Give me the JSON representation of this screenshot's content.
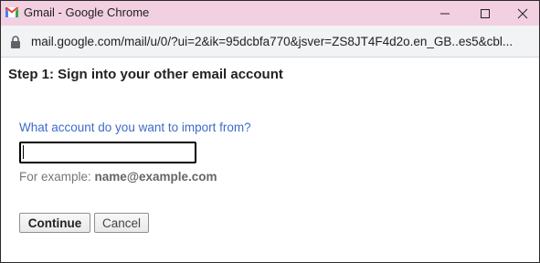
{
  "window": {
    "title": "Gmail - Google Chrome",
    "url": "mail.google.com/mail/u/0/?ui=2&ik=95dcbfa770&jsver=ZS8JT4F4d2o.en_GB..es5&cbl..."
  },
  "icons": {
    "app": "gmail-logo",
    "lock": "lock-icon",
    "minimize": "minimize-icon",
    "maximize": "maximize-icon",
    "close": "close-icon"
  },
  "colors": {
    "titlebar_bg": "#f2cfe1",
    "question_text": "#3d6bcc"
  },
  "form": {
    "step_title": "Step 1: Sign into your other email account",
    "question": "What account do you want to import from?",
    "email_value": "",
    "example_prefix": "For example:",
    "example_value": "name@example.com",
    "continue_label": "Continue",
    "cancel_label": "Cancel"
  }
}
